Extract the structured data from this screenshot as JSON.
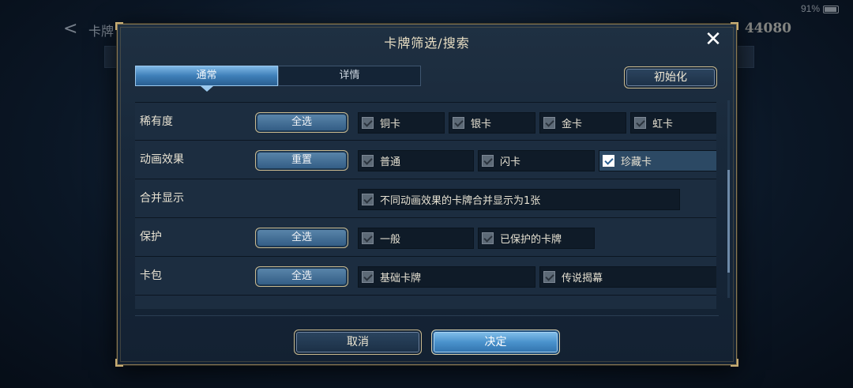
{
  "status_bar": {
    "battery": "91%"
  },
  "background": {
    "back_glyph": "<",
    "title": "卡牌",
    "coins": "44080"
  },
  "dialog": {
    "title": "卡牌筛选/搜索",
    "close_glyph": "✕",
    "tabs": [
      {
        "label": "通常",
        "active": true
      },
      {
        "label": "详情",
        "active": false
      }
    ],
    "reset_all_label": "初始化",
    "rows": [
      {
        "label": "稀有度",
        "button": "全选",
        "options": [
          {
            "label": "铜卡",
            "checked": true,
            "selected": false
          },
          {
            "label": "银卡",
            "checked": true,
            "selected": false
          },
          {
            "label": "金卡",
            "checked": true,
            "selected": false
          },
          {
            "label": "虹卡",
            "checked": true,
            "selected": false
          }
        ]
      },
      {
        "label": "动画效果",
        "button": "重置",
        "options": [
          {
            "label": "普通",
            "checked": true,
            "selected": false
          },
          {
            "label": "闪卡",
            "checked": true,
            "selected": false
          },
          {
            "label": "珍藏卡",
            "checked": true,
            "selected": true
          }
        ]
      },
      {
        "label": "合并显示",
        "button": "",
        "options": [
          {
            "label": "不同动画效果的卡牌合并显示为1张",
            "checked": true,
            "selected": false
          }
        ]
      },
      {
        "label": "保护",
        "button": "全选",
        "options": [
          {
            "label": "一般",
            "checked": true,
            "selected": false
          },
          {
            "label": "已保护的卡牌",
            "checked": true,
            "selected": false
          }
        ]
      },
      {
        "label": "卡包",
        "button": "全选",
        "options": [
          {
            "label": "基础卡牌",
            "checked": true,
            "selected": false
          },
          {
            "label": "传说揭幕",
            "checked": true,
            "selected": false
          }
        ]
      }
    ],
    "cancel_label": "取消",
    "confirm_label": "决定"
  },
  "colors": {
    "accent_blue": "#4a92cc",
    "gold_border": "#c9b98e",
    "panel_bg": "#1c2d40"
  }
}
